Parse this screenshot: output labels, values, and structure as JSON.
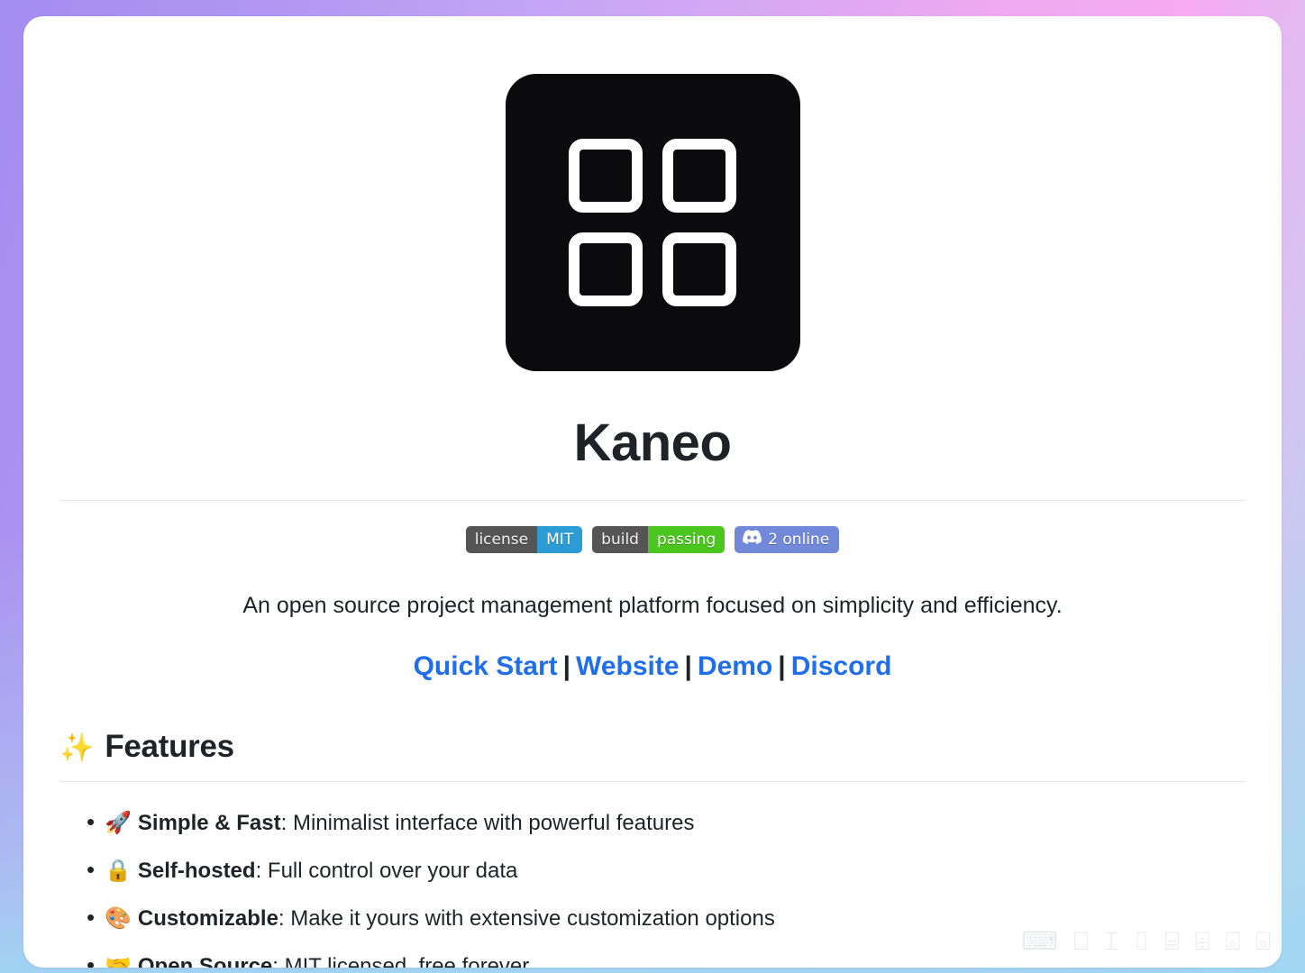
{
  "background": {
    "gradient_start": "#a48cf0",
    "gradient_mid": "#efa9f0",
    "gradient_end": "#a9d7ef"
  },
  "logo": {
    "name": "kaneo-logo",
    "background_color": "#0b0b0d",
    "tile_color": "#ffffff",
    "tiles": 4
  },
  "header": {
    "title": "Kaneo"
  },
  "badges": [
    {
      "id": "license-badge",
      "left_label": "license",
      "right_label": "MIT",
      "left_color": "#555555",
      "right_color": "#2d9bd4"
    },
    {
      "id": "build-badge",
      "left_label": "build",
      "right_label": "passing",
      "left_color": "#555555",
      "right_color": "#4ac61e"
    },
    {
      "id": "discord-badge",
      "icon": "discord-icon",
      "label": "2 online",
      "color": "#7289da"
    }
  ],
  "description": "An open source project management platform focused on simplicity and efficiency.",
  "links": {
    "separator": "|",
    "items": [
      {
        "label": "Quick Start"
      },
      {
        "label": "Website"
      },
      {
        "label": "Demo"
      },
      {
        "label": "Discord"
      }
    ],
    "color": "#1f6feb"
  },
  "features": {
    "emoji": "✨",
    "heading": "Features",
    "items": [
      {
        "emoji": "🚀",
        "term": "Simple & Fast",
        "separator": ":",
        "description": " Minimalist interface with powerful features"
      },
      {
        "emoji": "🔒",
        "term": "Self-hosted",
        "separator": ":",
        "description": " Full control over your data"
      },
      {
        "emoji": "🎨",
        "term": "Customizable",
        "separator": ":",
        "description": " Make it yours with extensive customization options"
      },
      {
        "emoji": "🤝",
        "term": "Open Source",
        "separator": ":",
        "description": " MIT licensed, free forever"
      }
    ]
  },
  "watermark": {
    "text": "⌨ ⎕ ⌶ ⌷ ⌸ ⌹ ⌺ ⌻"
  }
}
